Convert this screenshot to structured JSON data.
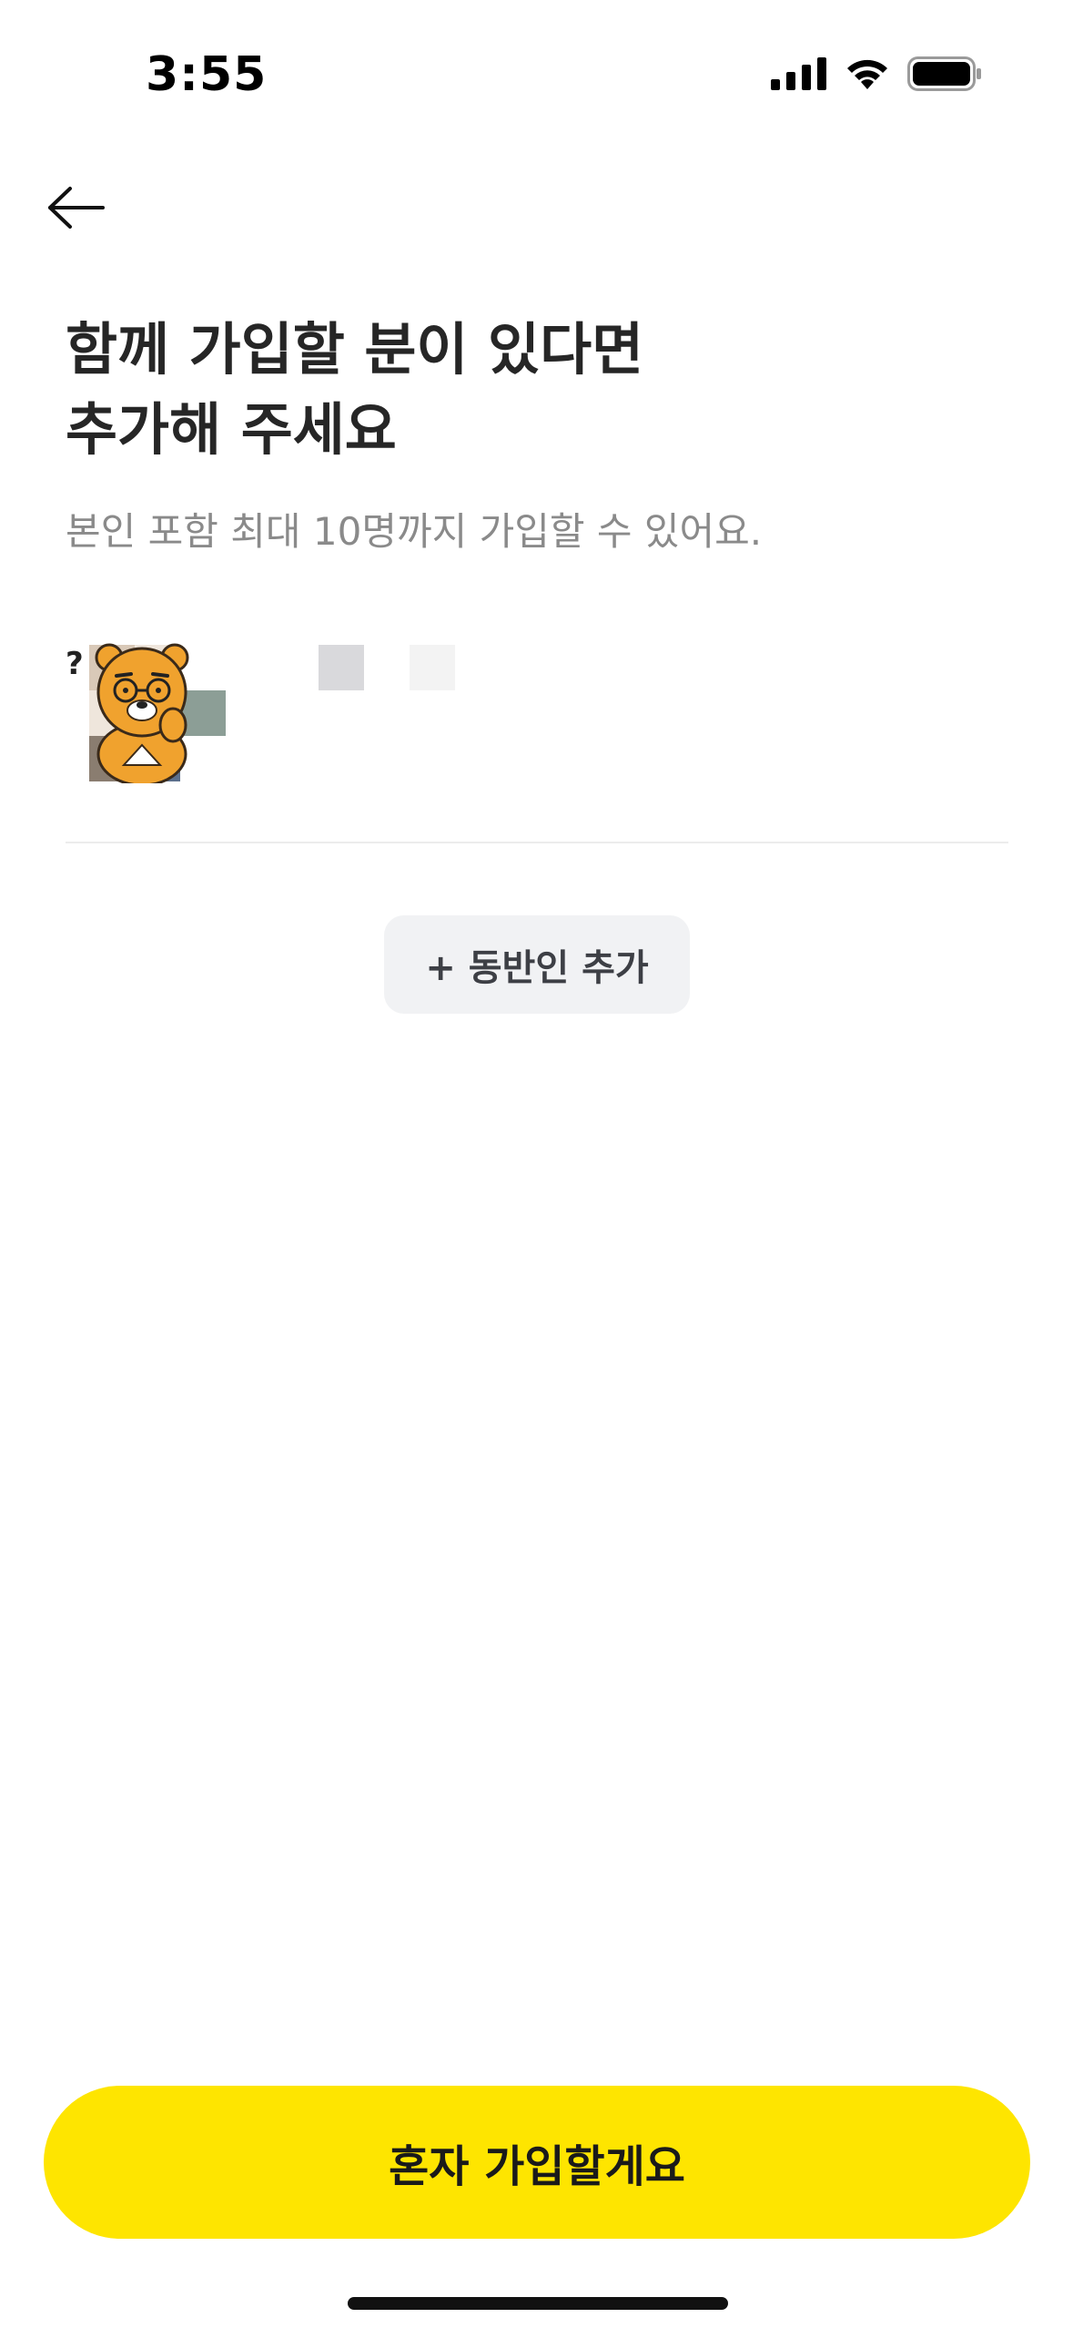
{
  "status_bar": {
    "time": "3:55",
    "icons": [
      "cellular-signal-icon",
      "wifi-icon",
      "battery-icon"
    ]
  },
  "header": {
    "back_icon": "arrow-left-icon"
  },
  "title": {
    "line1": "함께 가입할 분이 있다면",
    "line2": "추가해 주세요"
  },
  "subtitle": "본인 포함 최대 10명까지 가입할 수 있어요.",
  "member": {
    "avatar_icon": "character-avatar-icon"
  },
  "add_companion": {
    "label": "+ 동반인 추가"
  },
  "cta": {
    "label": "혼자 가입할게요"
  },
  "colors": {
    "cta_background": "#fee500",
    "add_button_background": "#f1f2f4",
    "subtitle_text": "#8a8a8a"
  }
}
